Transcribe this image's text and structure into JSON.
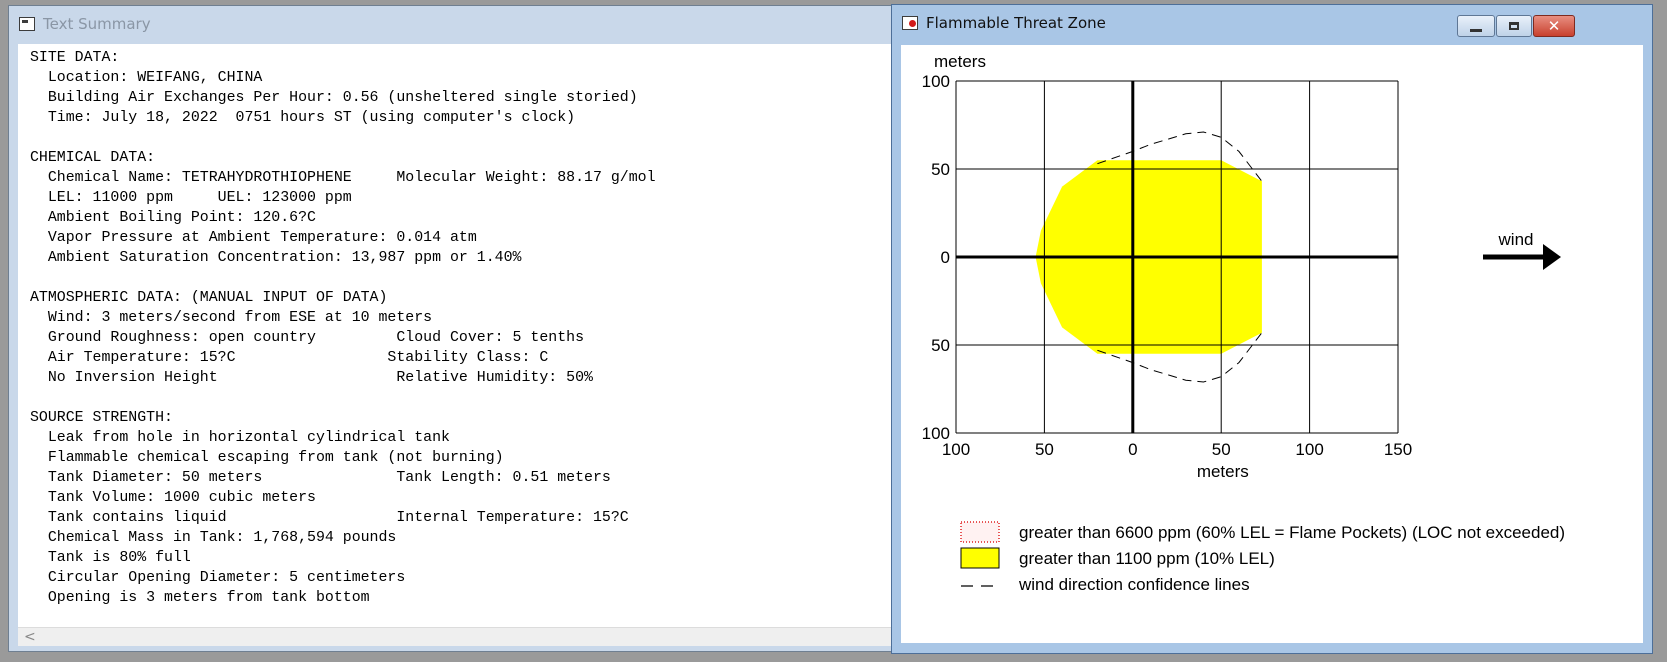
{
  "text_window": {
    "title": "Text Summary",
    "body": "SITE DATA:\n  Location: WEIFANG, CHINA\n  Building Air Exchanges Per Hour: 0.56 (unsheltered single storied)\n  Time: July 18, 2022  0751 hours ST (using computer's clock)\n\nCHEMICAL DATA:\n  Chemical Name: TETRAHYDROTHIOPHENE     Molecular Weight: 88.17 g/mol\n  LEL: 11000 ppm     UEL: 123000 ppm\n  Ambient Boiling Point: 120.6?C\n  Vapor Pressure at Ambient Temperature: 0.014 atm\n  Ambient Saturation Concentration: 13,987 ppm or 1.40%\n\nATMOSPHERIC DATA: (MANUAL INPUT OF DATA)\n  Wind: 3 meters/second from ESE at 10 meters\n  Ground Roughness: open country         Cloud Cover: 5 tenths\n  Air Temperature: 15?C                 Stability Class: C\n  No Inversion Height                    Relative Humidity: 50%\n\nSOURCE STRENGTH:\n  Leak from hole in horizontal cylindrical tank\n  Flammable chemical escaping from tank (not burning)\n  Tank Diameter: 50 meters               Tank Length: 0.51 meters\n  Tank Volume: 1000 cubic meters\n  Tank contains liquid                   Internal Temperature: 15?C\n  Chemical Mass in Tank: 1,768,594 pounds\n  Tank is 80% full\n  Circular Opening Diameter: 5 centimeters\n  Opening is 3 meters from tank bottom",
    "scroll_arrow": "<"
  },
  "threat_window": {
    "title": "Flammable Threat Zone",
    "buttons": {
      "close": "✕"
    }
  },
  "chart_data": {
    "type": "area",
    "title": "",
    "xlabel": "meters",
    "ylabel": "meters",
    "xlim": [
      -100,
      150
    ],
    "ylim": [
      -100,
      100
    ],
    "x_ticks": [
      -100,
      -50,
      0,
      50,
      100,
      150
    ],
    "x_tick_labels": [
      "100",
      "50",
      "0",
      "50",
      "100",
      "150"
    ],
    "y_ticks": [
      100,
      50,
      0,
      -50,
      -100
    ],
    "y_tick_labels": [
      "100",
      "50",
      "0",
      "50",
      "100"
    ],
    "grid": true,
    "wind_label": "wind",
    "zones": [
      {
        "name": "greater than 1100 ppm (10% LEL)",
        "color": "#ffff00",
        "shape": [
          [
            50,
            55
          ],
          [
            73,
            43
          ],
          [
            73,
            -43
          ],
          [
            50,
            -55
          ],
          [
            -20,
            -55
          ],
          [
            -40,
            -40
          ],
          [
            -52,
            -15
          ],
          [
            -55,
            0
          ],
          [
            -52,
            15
          ],
          [
            -40,
            40
          ],
          [
            -20,
            55
          ]
        ]
      }
    ],
    "confidence_lines": [
      [
        [
          -20,
          53
        ],
        [
          0,
          60
        ],
        [
          10,
          64
        ],
        [
          20,
          67
        ],
        [
          30,
          70
        ],
        [
          40,
          71
        ],
        [
          50,
          68
        ],
        [
          60,
          60
        ],
        [
          73,
          43
        ]
      ],
      [
        [
          -20,
          -53
        ],
        [
          0,
          -60
        ],
        [
          10,
          -64
        ],
        [
          20,
          -67
        ],
        [
          30,
          -70
        ],
        [
          40,
          -71
        ],
        [
          50,
          -68
        ],
        [
          60,
          -60
        ],
        [
          73,
          -43
        ]
      ]
    ],
    "legend": [
      {
        "label": "greater than 6600 ppm (60% LEL = Flame Pockets) (LOC not exceeded)",
        "swatch": "dotted-red",
        "color": "#e02020"
      },
      {
        "label": "greater than 1100 ppm (10% LEL)",
        "swatch": "fill",
        "color": "#ffff00"
      },
      {
        "label": "wind direction confidence lines",
        "swatch": "dashed",
        "color": "#000000"
      }
    ]
  }
}
